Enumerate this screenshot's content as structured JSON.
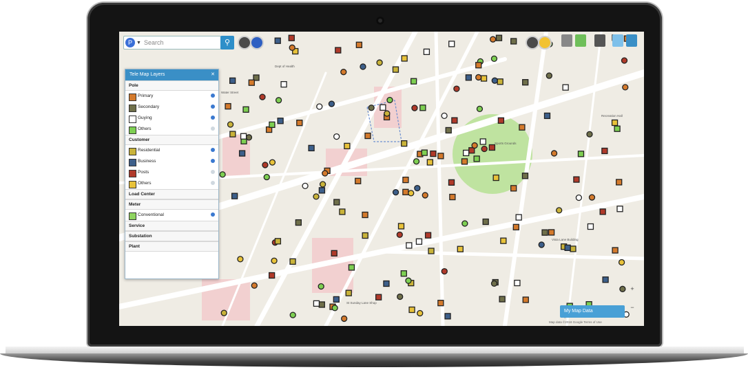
{
  "toolbar": {
    "search_placeholder": "Search",
    "search_logo": "P",
    "search_icon": "magnifier-icon",
    "tools": [
      "locate-icon",
      "globe-icon",
      "badge-icon",
      "settings-icon",
      "layers-icon",
      "map-icon",
      "print-icon",
      "share-icon",
      "user-icon"
    ]
  },
  "layers_panel": {
    "title": "Tele Map Layers",
    "sections": [
      {
        "label": "Pole",
        "items": [
          {
            "label": "Primary",
            "color": "#d47a2c",
            "on": true
          },
          {
            "label": "Secondary",
            "color": "#6f6f4a",
            "on": true
          },
          {
            "label": "Guying",
            "color": "#ffffff",
            "on": true
          },
          {
            "label": "Others",
            "color": "#7ecf52",
            "on": false
          }
        ]
      },
      {
        "label": "Customer",
        "items": [
          {
            "label": "Residential",
            "color": "#c9b33a",
            "on": true
          },
          {
            "label": "Business",
            "color": "#3d5f8a",
            "on": true
          },
          {
            "label": "Posts",
            "color": "#b03a2a",
            "on": false
          },
          {
            "label": "Others",
            "color": "#e8c23a",
            "on": false
          }
        ]
      },
      {
        "label": "Load Center",
        "items": []
      },
      {
        "label": "Meter",
        "items": [
          {
            "label": "Conventional",
            "color": "#8fd460",
            "on": true
          }
        ]
      },
      {
        "label": "Service",
        "items": []
      },
      {
        "label": "Substation",
        "items": []
      },
      {
        "label": "Plant",
        "items": []
      }
    ]
  },
  "map": {
    "button_label": "My Map Data",
    "zoom_in": "+",
    "zoom_out": "−",
    "attribution": "Map data ©2018 Google   Terms of Use",
    "colors": {
      "land": "#efece4",
      "road": "#ffffff",
      "park": "#bfe3a0",
      "poi_area": "#f2d0d0",
      "marker_border": "#222222"
    }
  }
}
